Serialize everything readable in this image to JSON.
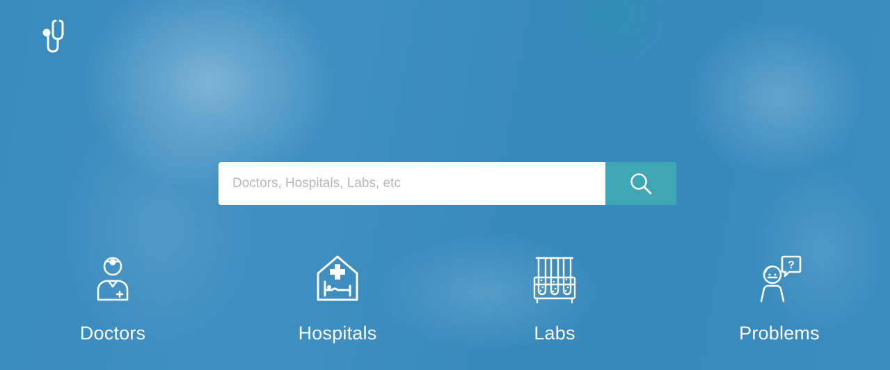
{
  "brand": {
    "logo_icon": "stethoscope-icon"
  },
  "search": {
    "placeholder": "Doctors, Hospitals, Labs, etc",
    "value": "",
    "button_icon": "search-icon"
  },
  "categories": [
    {
      "label": "Doctors",
      "icon": "doctor-icon"
    },
    {
      "label": "Hospitals",
      "icon": "hospital-icon"
    },
    {
      "label": "Labs",
      "icon": "test-tubes-icon"
    },
    {
      "label": "Problems",
      "icon": "patient-question-icon"
    }
  ],
  "colors": {
    "background": "#3a8bbd",
    "search_button": "#3ea6b5",
    "text": "#ffffff"
  }
}
